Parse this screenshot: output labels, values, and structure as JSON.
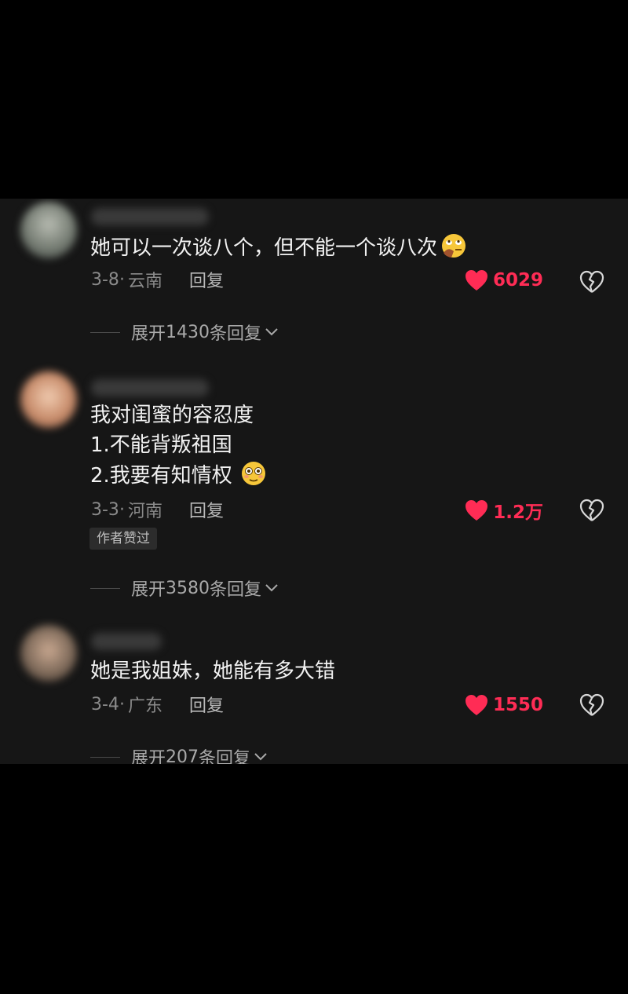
{
  "comments": [
    {
      "text": "她可以一次谈八个，但不能一个谈八次",
      "emoji": "face-with-rolling-eyes-emoji",
      "date": "3-8",
      "location": "云南",
      "reply_label": "回复",
      "likes": "6029",
      "expand": {
        "prefix": "展开",
        "count": "1430",
        "suffix": "条回复"
      },
      "avatar_color": "#8a8f86"
    },
    {
      "text": "我对闺蜜的容忍度\n1.不能背叛祖国\n2.我要有知情权",
      "emoji": "flushed-face-emoji",
      "date": "3-3",
      "location": "河南",
      "reply_label": "回复",
      "likes": "1.2万",
      "badge": "作者赞过",
      "expand": {
        "prefix": "展开",
        "count": "3580",
        "suffix": "条回复"
      },
      "avatar_color": "#b88a6e"
    },
    {
      "text": "她是我姐妹，她能有多大错",
      "date": "3-4",
      "location": "广东",
      "reply_label": "回复",
      "likes": "1550",
      "expand": {
        "prefix": "展开",
        "count": "207",
        "suffix": "条回复"
      },
      "avatar_color": "#7e6a5a"
    }
  ],
  "colors": {
    "background": "#000000",
    "panel": "#161616",
    "like_red": "#ff2c55",
    "text": "#f2f2f2",
    "meta_gray": "#8a8a8a"
  }
}
